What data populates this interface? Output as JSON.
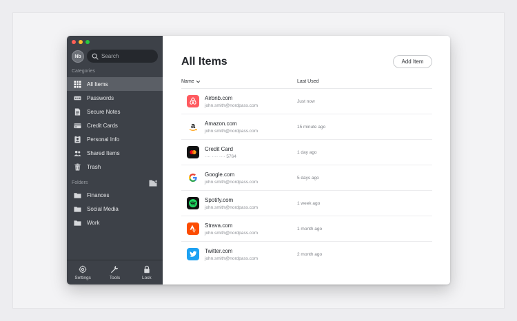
{
  "sidebar": {
    "avatar_initials": "Nb",
    "search_placeholder": "Search",
    "categories_label": "Categories",
    "categories": [
      {
        "label": "All Items",
        "icon": "grid-icon",
        "active": true
      },
      {
        "label": "Passwords",
        "icon": "password-icon"
      },
      {
        "label": "Secure Notes",
        "icon": "note-icon"
      },
      {
        "label": "Credit Cards",
        "icon": "credit-card-icon"
      },
      {
        "label": "Personal Info",
        "icon": "id-card-icon"
      },
      {
        "label": "Shared Items",
        "icon": "people-icon"
      },
      {
        "label": "Trash",
        "icon": "trash-icon"
      }
    ],
    "folders_label": "Folders",
    "folders": [
      {
        "label": "Finances",
        "icon": "folder-icon"
      },
      {
        "label": "Social Media",
        "icon": "folder-icon"
      },
      {
        "label": "Work",
        "icon": "folder-icon"
      }
    ],
    "bottom": [
      {
        "label": "Settings",
        "icon": "gear-icon"
      },
      {
        "label": "Tools",
        "icon": "wrench-icon"
      },
      {
        "label": "Lock",
        "icon": "lock-icon"
      }
    ]
  },
  "main": {
    "title": "All Items",
    "add_button": "Add Item",
    "columns": {
      "name": "Name",
      "last_used": "Last Used"
    },
    "items": [
      {
        "title": "Airbnb.com",
        "subtitle": "john.smith@nordpass.com",
        "last_used": "Just now",
        "logo": "airbnb-logo"
      },
      {
        "title": "Amazon.com",
        "subtitle": "john.smith@nordpass.com",
        "last_used": "15 minute ago",
        "logo": "amazon-logo"
      },
      {
        "title": "Credit Card",
        "subtitle": "···· ···· ···· 5764",
        "last_used": "1 day ago",
        "logo": "mastercard-logo"
      },
      {
        "title": "Google.com",
        "subtitle": "john.smith@nordpass.com",
        "last_used": "5 days ago",
        "logo": "google-logo"
      },
      {
        "title": "Spotify.com",
        "subtitle": "john.smith@nordpass.com",
        "last_used": "1 week ago",
        "logo": "spotify-logo"
      },
      {
        "title": "Strava.com",
        "subtitle": "john.smith@nordpass.com",
        "last_used": "1 month ago",
        "logo": "strava-logo"
      },
      {
        "title": "Twitter.com",
        "subtitle": "john.smith@nordpass.com",
        "last_used": "2 month ago",
        "logo": "twitter-logo"
      }
    ]
  },
  "colors": {
    "sidebar_bg": "#3d4148",
    "sidebar_active": "#5b5f66",
    "airbnb": "#ff5a5f",
    "spotify": "#1ed760",
    "strava": "#fc4c02",
    "twitter": "#1da1f2"
  }
}
